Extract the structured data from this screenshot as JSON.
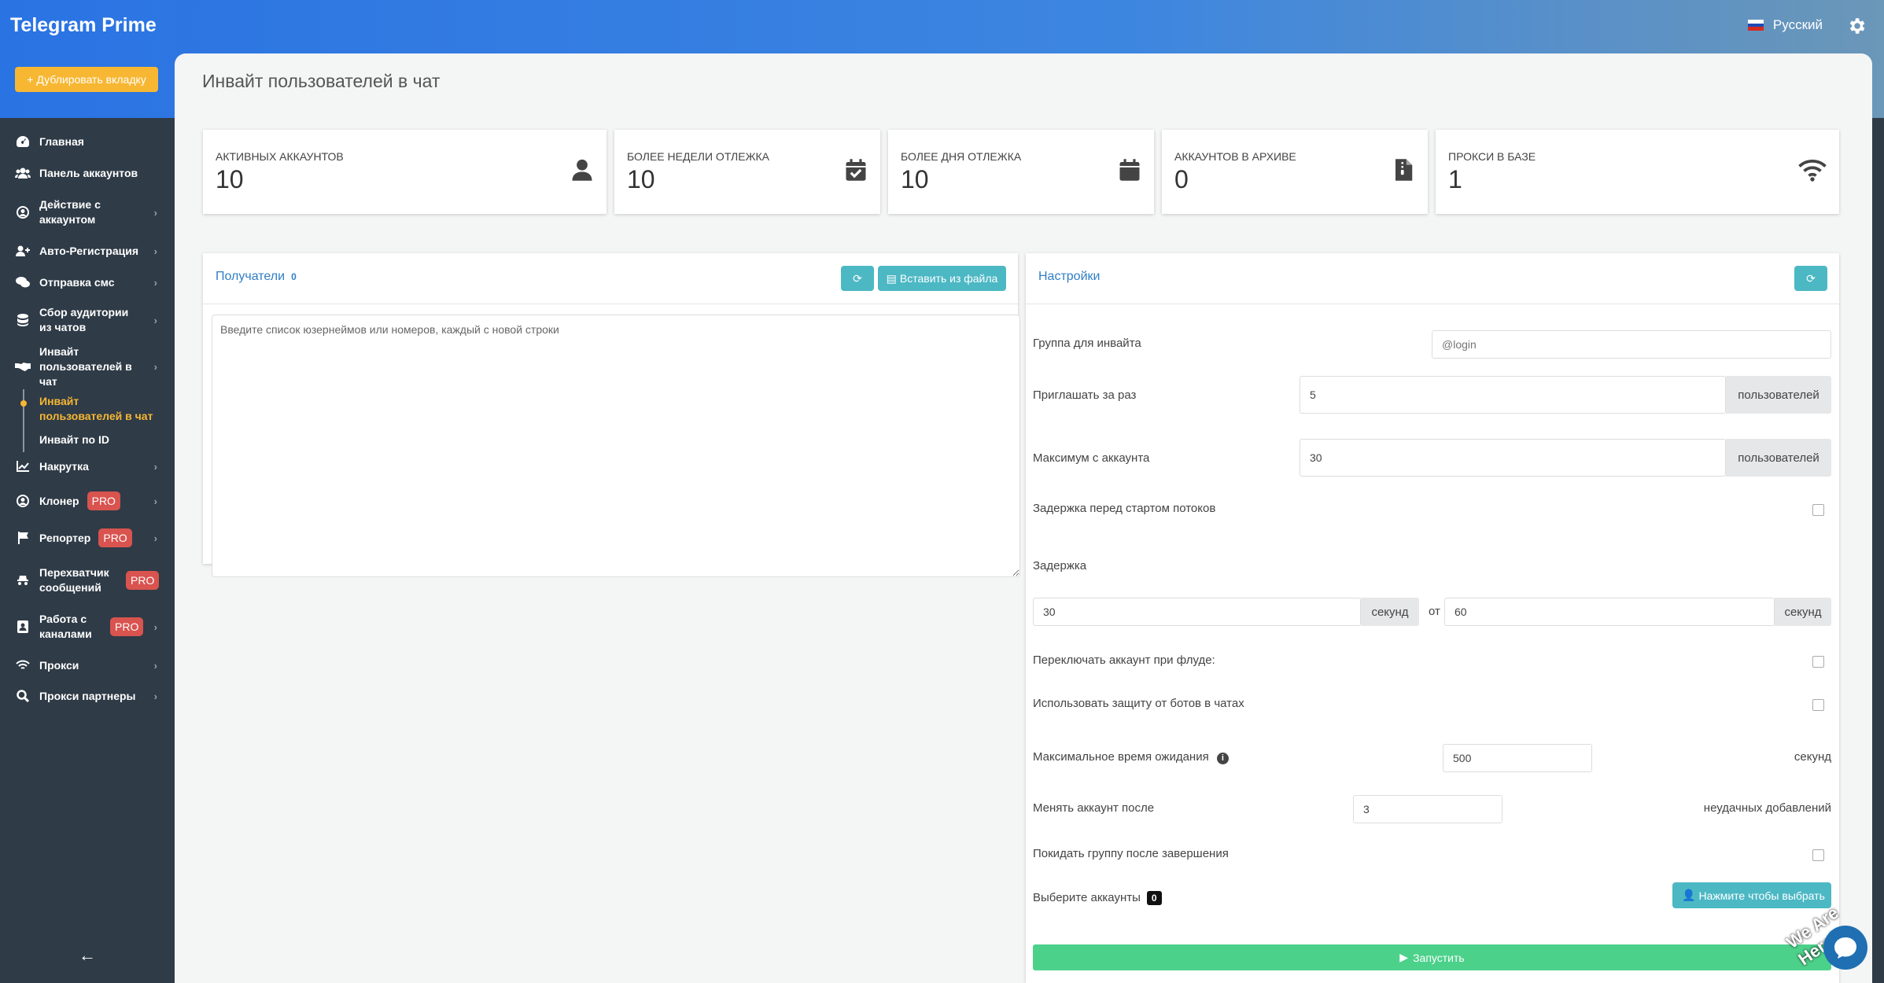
{
  "app": {
    "title": "Telegram Prime",
    "duplicate_tab": "Дублировать вкладку",
    "language": "Русский"
  },
  "sidebar": {
    "items": [
      {
        "label": "Главная",
        "icon": "dashboard-icon"
      },
      {
        "label": "Панель аккаунтов",
        "icon": "users-icon"
      },
      {
        "label": "Действие с аккаунтом",
        "icon": "account-circle-icon"
      },
      {
        "label": "Авто-Регистрация",
        "icon": "user-plus-icon"
      },
      {
        "label": "Отправка смс",
        "icon": "comments-icon"
      },
      {
        "label": "Сбор аудитории из чатов",
        "icon": "database-icon"
      },
      {
        "label": "Инвайт пользователей в чат",
        "icon": "handshake-icon"
      },
      {
        "label": "Накрутка",
        "icon": "chart-line-icon"
      },
      {
        "label": "Клонер",
        "icon": "clone-icon",
        "badge": "PRO"
      },
      {
        "label": "Репортер",
        "icon": "flag-icon",
        "badge": "PRO"
      },
      {
        "label": "Перехватчик сообщений",
        "icon": "spy-icon",
        "badge": "PRO"
      },
      {
        "label": "Работа с каналами",
        "icon": "id-card-icon",
        "badge": "PRO"
      },
      {
        "label": "Прокси",
        "icon": "wifi-icon"
      },
      {
        "label": "Прокси партнеры",
        "icon": "search-icon"
      }
    ],
    "subitems": [
      {
        "label": "Инвайт пользователей в чат",
        "active": true
      },
      {
        "label": "Инвайт по ID",
        "active": false
      }
    ]
  },
  "page": {
    "title": "Инвайт пользователей в чат"
  },
  "stats": [
    {
      "label": "Активных аккаунтов",
      "value": "10",
      "icon": "user-icon"
    },
    {
      "label": "Более недели отлежка",
      "value": "10",
      "icon": "calendar-check-icon"
    },
    {
      "label": "Более дня отлежка",
      "value": "10",
      "icon": "calendar-icon"
    },
    {
      "label": "Аккаунтов в архиве",
      "value": "0",
      "icon": "archive-file-icon"
    },
    {
      "label": "Прокси в базе",
      "value": "1",
      "icon": "wifi-icon"
    }
  ],
  "recipients": {
    "title": "Получатели",
    "count": "0",
    "insert_from_file": "Вставить из файла",
    "placeholder": "Введите список юзернеймов или номеров, каждый с новой строки"
  },
  "settings": {
    "title": "Настройки",
    "group_label": "Группа для инвайта",
    "group_placeholder": "@login",
    "per_time_label": "Приглашать за раз",
    "per_time_value": "5",
    "users_addon": "пользователей",
    "max_label": "Максимум с аккаунта",
    "max_value": "30",
    "delay_start_label": "Задержка перед стартом потоков",
    "delay_label": "Задержка",
    "delay_from": "30",
    "delay_to": "60",
    "seconds_addon": "секунд",
    "from_word": "от",
    "switch_flood_label": "Переключать аккаунт при флуде:",
    "bot_protection_label": "Использовать защиту от ботов в чатах",
    "max_wait_label": "Максимальное время ожидания",
    "max_wait_value": "500",
    "max_wait_unit": "секунд",
    "change_after_label": "Менять аккаунт после",
    "change_after_value": "3",
    "change_after_unit": "неудачных добавлений",
    "leave_group_label": "Покидать группу после завершения",
    "select_accounts_label": "Выберите аккаунты",
    "select_accounts_count": "0",
    "select_button": "Нажмите чтобы выбрать",
    "run_button": "Запустить"
  },
  "widget": {
    "text": "We Are Here!"
  }
}
